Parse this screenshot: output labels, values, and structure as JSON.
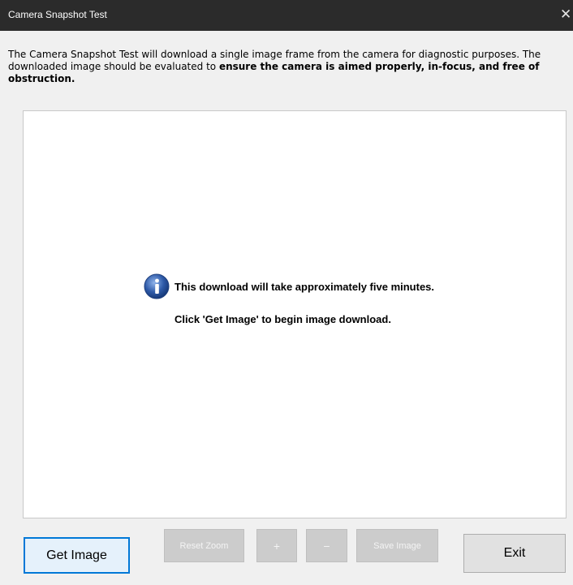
{
  "window": {
    "title": "Camera Snapshot Test",
    "close_glyph": "✕"
  },
  "description": {
    "text_normal": "The Camera Snapshot Test will download a single image frame from the camera for diagnostic purposes.  The downloaded image should be evaluated to ",
    "text_bold": "ensure the camera is aimed properly, in-focus, and free of obstruction."
  },
  "viewer": {
    "info_icon": "info-icon",
    "info_message": "This download will take approximately five minutes.",
    "hint_message": "Click 'Get Image' to begin image download."
  },
  "buttons": {
    "get_image": "Get Image",
    "reset_zoom": "Reset Zoom",
    "zoom_in": "+",
    "zoom_out": "−",
    "save_image": "Save Image",
    "exit": "Exit"
  },
  "colors": {
    "titlebar": "#2b2b2b",
    "accent": "#0078d7",
    "info_icon_blue": "#2e5aa8"
  }
}
